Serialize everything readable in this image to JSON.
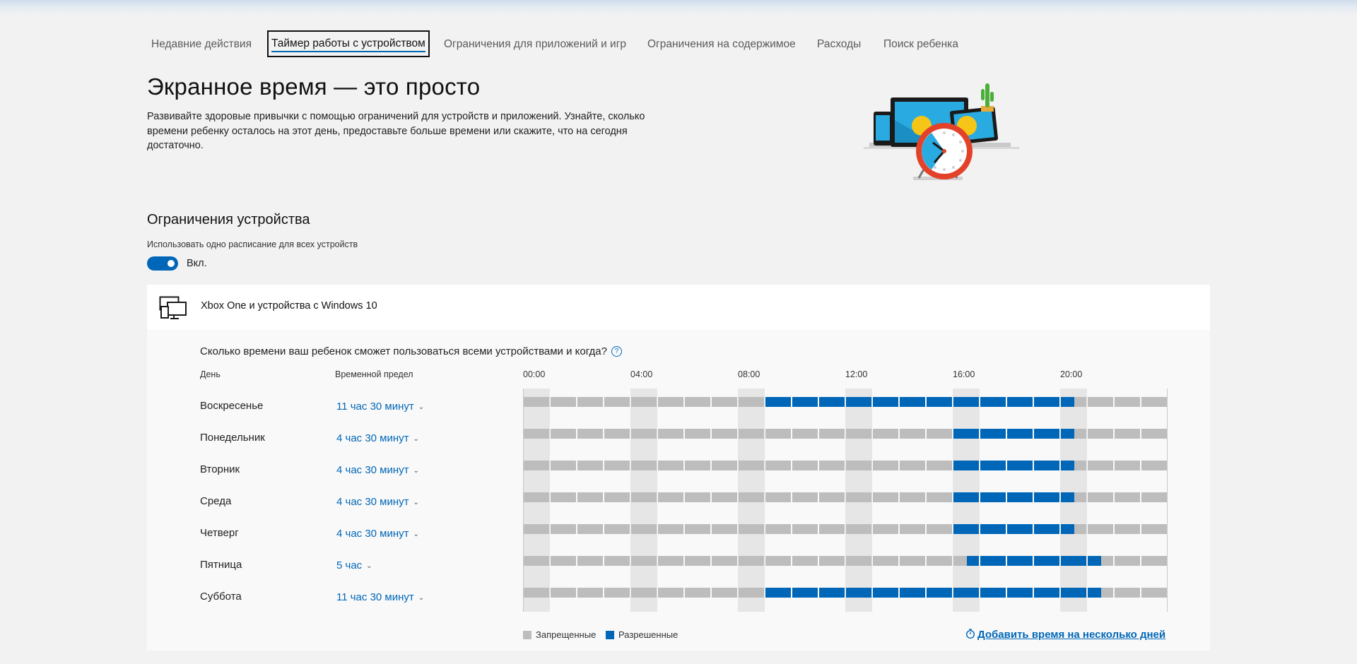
{
  "tabs": [
    {
      "label": "Недавние действия",
      "active": false
    },
    {
      "label": "Таймер работы с устройством",
      "active": true
    },
    {
      "label": "Ограничения для приложений и игр",
      "active": false
    },
    {
      "label": "Ограничения на содержимое",
      "active": false
    },
    {
      "label": "Расходы",
      "active": false
    },
    {
      "label": "Поиск ребенка",
      "active": false
    }
  ],
  "header": {
    "title": "Экранное время — это просто",
    "description": "Развивайте здоровые привычки с помощью ограничений для устройств и приложений. Узнайте, сколько времени ребенку осталось на этот день, предоставьте больше времени или скажите, что на сегодня достаточно."
  },
  "device_limits": {
    "heading": "Ограничения устройства",
    "schedule_label": "Использовать одно расписание для всех устройств",
    "toggle_state": "Вкл.",
    "toggle_on": true
  },
  "device_card": {
    "name": "Xbox One и устройства с Windows 10",
    "icon": "devices-icon",
    "question": "Сколько времени ваш ребенок сможет пользоваться всеми устройствами и когда?",
    "help_icon": "?",
    "col_day": "День",
    "col_limit": "Временной предел",
    "time_labels": [
      "00:00",
      "04:00",
      "08:00",
      "12:00",
      "16:00",
      "20:00"
    ],
    "days": [
      {
        "name": "Воскресенье",
        "limit": "11 час 30 минут",
        "allowed_from": 9,
        "allowed_to": 20.5
      },
      {
        "name": "Понедельник",
        "limit": "4 час 30 минут",
        "allowed_from": 16,
        "allowed_to": 20.5
      },
      {
        "name": "Вторник",
        "limit": "4 час 30 минут",
        "allowed_from": 16,
        "allowed_to": 20.5
      },
      {
        "name": "Среда",
        "limit": "4 час 30 минут",
        "allowed_from": 16,
        "allowed_to": 20.5
      },
      {
        "name": "Четверг",
        "limit": "4 час 30 минут",
        "allowed_from": 16,
        "allowed_to": 20.5
      },
      {
        "name": "Пятница",
        "limit": "5 час",
        "allowed_from": 16.5,
        "allowed_to": 21.5
      },
      {
        "name": "Суббота",
        "limit": "11 час 30 минут",
        "allowed_from": 9,
        "allowed_to": 21.5
      }
    ],
    "legend": {
      "blocked": "Запрещенные",
      "allowed": "Разрешенные"
    },
    "add_time_link": "Добавить время на несколько дней",
    "add_time_icon": "timer-icon"
  },
  "colors": {
    "accent": "#0067b8",
    "allowed": "#0067b8",
    "blocked": "#bdbdbd"
  }
}
